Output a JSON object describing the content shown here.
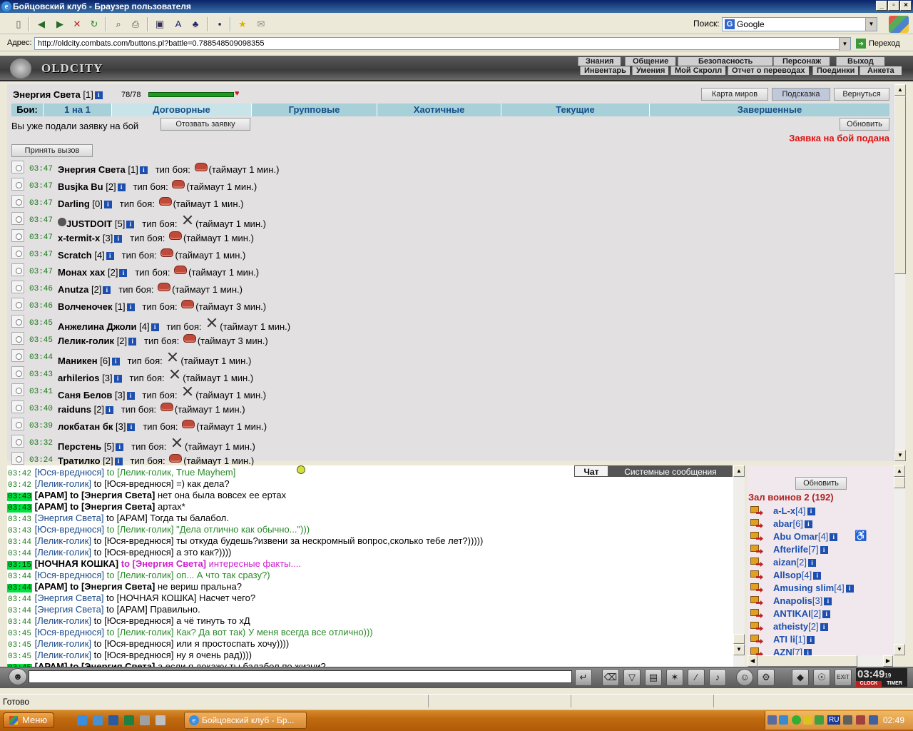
{
  "window": {
    "title": "Бойцовский клуб - Браузер пользователя"
  },
  "toolbar": {
    "search_label": "Поиск:",
    "search_value": "Google"
  },
  "address": {
    "label": "Адрес:",
    "url": "http://oldcity.combats.com/buttons.pl?battle=0.788548509098355",
    "go": "Переход"
  },
  "game": {
    "logo": "OLDCITY",
    "menu_top": [
      "Знания",
      "Общение",
      "Безопасность",
      "Персонаж",
      "Выход"
    ],
    "menu_bottom": [
      "Инвентарь",
      "Умения",
      "Мой Скролл",
      "Отчет о переводах",
      "Поединки",
      "Анкета"
    ]
  },
  "char": {
    "name": "Энергия Света",
    "level": "[1]",
    "hp": "78/78",
    "hp_fraction": 1.0
  },
  "buttons": {
    "map": "Карта миров",
    "hint": "Подсказка",
    "back": "Вернуться",
    "refresh": "Обновить",
    "withdraw": "Отозвать заявку",
    "accept": "Принять вызов"
  },
  "tabs": {
    "label": "Бои:",
    "items": [
      "1 на 1",
      "Договорные",
      "Групповые",
      "Хаотичные",
      "Текущие",
      "Завершенные"
    ]
  },
  "applied_text": "Вы уже подали заявку на бой",
  "status_text": "Заявка на бой подана",
  "fight_type_label": "тип боя:",
  "fights": [
    {
      "time": "03:47",
      "name": "Энергия Света",
      "level": "[1]",
      "type": "fist",
      "timeout": "(таймаут 1 мин.)"
    },
    {
      "time": "03:47",
      "name": "Busjka Bu",
      "level": "[2]",
      "type": "fist",
      "timeout": "(таймаут 1 мин.)"
    },
    {
      "time": "03:47",
      "name": "Darling",
      "level": "[0]",
      "type": "fist",
      "timeout": "(таймаут 1 мин.)"
    },
    {
      "time": "03:47",
      "name": "JUSTDOIT",
      "level": "[5]",
      "type": "swords",
      "timeout": "(таймаут 1 мин.)"
    },
    {
      "time": "03:47",
      "name": "x-termit-x",
      "level": "[3]",
      "type": "fist",
      "timeout": "(таймаут 1 мин.)"
    },
    {
      "time": "03:47",
      "name": "Scratch",
      "level": "[4]",
      "type": "fist",
      "timeout": "(таймаут 1 мин.)"
    },
    {
      "time": "03:47",
      "name": "Монах хах",
      "level": "[2]",
      "type": "fist",
      "timeout": "(таймаут 1 мин.)"
    },
    {
      "time": "03:46",
      "name": "Anutza",
      "level": "[2]",
      "type": "fist",
      "timeout": "(таймаут 1 мин.)"
    },
    {
      "time": "03:46",
      "name": "Волченочек",
      "level": "[1]",
      "type": "fist",
      "timeout": "(таймаут 3 мин.)"
    },
    {
      "time": "03:45",
      "name": "Анжелина Джоли",
      "level": "[4]",
      "type": "swords",
      "timeout": "(таймаут 1 мин.)"
    },
    {
      "time": "03:45",
      "name": "Лелик-голик",
      "level": "[2]",
      "type": "fist",
      "timeout": "(таймаут 3 мин.)"
    },
    {
      "time": "03:44",
      "name": "Маникен",
      "level": "[6]",
      "type": "swords",
      "timeout": "(таймаут 1 мин.)"
    },
    {
      "time": "03:43",
      "name": "arhilerios",
      "level": "[3]",
      "type": "swords",
      "timeout": "(таймаут 1 мин.)"
    },
    {
      "time": "03:41",
      "name": "Саня Белов",
      "level": "[3]",
      "type": "swords",
      "timeout": "(таймаут 1 мин.)"
    },
    {
      "time": "03:40",
      "name": "raiduns",
      "level": "[2]",
      "type": "fist",
      "timeout": "(таймаут 1 мин.)"
    },
    {
      "time": "03:39",
      "name": "локбатан бк",
      "level": "[3]",
      "type": "fist",
      "timeout": "(таймаут 1 мин.)"
    },
    {
      "time": "03:32",
      "name": "Перстень",
      "level": "[5]",
      "type": "swords",
      "timeout": "(таймаут 1 мин.)"
    },
    {
      "time": "03:24",
      "name": "Тратилко",
      "level": "[2]",
      "type": "fist",
      "timeout": "(таймаут 1 мин.)"
    }
  ],
  "chat_tabs": [
    "Чат",
    "Системные сообщения"
  ],
  "chat": [
    {
      "t": "03:42",
      "hl": false,
      "from": "[Юся-вреднюся]",
      "to": "to [Лелик-голик, True Mayhem]",
      "msg": "",
      "color": "#2a8a2a",
      "bold": false
    },
    {
      "t": "03:42",
      "hl": false,
      "from": "[Лелик-голик]",
      "to": "to [Юся-вреднюся]",
      "msg": "=) как дела?",
      "color": "#000000",
      "bold": false
    },
    {
      "t": "03:43",
      "hl": true,
      "from": "[АРАМ]",
      "to": "to [Энергия Света]",
      "msg": "нет она была вовсех ее ертах",
      "color": "#000000",
      "bold": true
    },
    {
      "t": "03:43",
      "hl": true,
      "from": "[АРАМ]",
      "to": "to [Энергия Света]",
      "msg": "артах*",
      "color": "#000000",
      "bold": true
    },
    {
      "t": "03:43",
      "hl": false,
      "from": "[Энергия Света]",
      "to": "to [АРАМ]",
      "msg": "Тогда ты балабол.",
      "color": "#000000",
      "bold": false
    },
    {
      "t": "03:43",
      "hl": false,
      "from": "[Юся-вреднюся]",
      "to": "to [Лелик-голик]",
      "msg": "\"Дела отлично как обычно...\")))",
      "color": "#2a8a2a",
      "bold": false
    },
    {
      "t": "03:44",
      "hl": false,
      "from": "[Лелик-голик]",
      "to": "to [Юся-вреднюся]",
      "msg": "ты откуда будешь?извени за нескромный вопрос,сколько тебе лет?)))))",
      "color": "#000000",
      "bold": false
    },
    {
      "t": "03:44",
      "hl": false,
      "from": "[Лелик-голик]",
      "to": "to [Юся-вреднюся]",
      "msg": "а это как?))))",
      "color": "#000000",
      "bold": false
    },
    {
      "t": "03:15",
      "hl": true,
      "from": "[НОЧНАЯ КОШКА]",
      "to": "to [Энергия Света]",
      "msg": "интересные факты....",
      "color": "#d020d0",
      "bold": true
    },
    {
      "t": "03:44",
      "hl": false,
      "from": "[Юся-вреднюся]",
      "to": "to [Лелик-голик]",
      "msg": "оп... А что так сразу?)",
      "color": "#2a8a2a",
      "bold": false
    },
    {
      "t": "03:44",
      "hl": true,
      "from": "[АРАМ]",
      "to": "to [Энергия Света]",
      "msg": "не вериш пральна?",
      "color": "#000000",
      "bold": true
    },
    {
      "t": "03:44",
      "hl": false,
      "from": "[Энергия Света]",
      "to": "to [НОЧНАЯ КОШКА]",
      "msg": "Насчет чего?",
      "color": "#000000",
      "bold": false
    },
    {
      "t": "03:44",
      "hl": false,
      "from": "[Энергия Света]",
      "to": "to [АРАМ]",
      "msg": "Правильно.",
      "color": "#000000",
      "bold": false
    },
    {
      "t": "03:44",
      "hl": false,
      "from": "[Лелик-голик]",
      "to": "to [Юся-вреднюся]",
      "msg": "а чё тинуть то хД",
      "color": "#000000",
      "bold": false
    },
    {
      "t": "03:45",
      "hl": false,
      "from": "[Юся-вреднюся]",
      "to": "to [Лелик-голик]",
      "msg": "Как? Да вот так) У меня всегда все отлично)))",
      "color": "#2a8a2a",
      "bold": false
    },
    {
      "t": "03:45",
      "hl": false,
      "from": "[Лелик-голик]",
      "to": "to [Юся-вреднюся]",
      "msg": "или я простоспать хочу))))",
      "color": "#000000",
      "bold": false
    },
    {
      "t": "03:45",
      "hl": false,
      "from": "[Лелик-голик]",
      "to": "to [Юся-вреднюся]",
      "msg": "ну я очень рад))))",
      "color": "#000000",
      "bold": false
    },
    {
      "t": "03:45",
      "hl": true,
      "from": "[АРАМ]",
      "to": "to [Энергия Света]",
      "msg": "а если я докажу ты балабол по жизни?",
      "color": "#000000",
      "bold": true
    }
  ],
  "room": {
    "refresh": "Обновить",
    "title": "Зал воинов 2 (192)",
    "users": [
      {
        "name": "a-L-x",
        "level": "[4]"
      },
      {
        "name": "abar",
        "level": "[6]"
      },
      {
        "name": "Abu Omar",
        "level": "[4]"
      },
      {
        "name": "Afterlife",
        "level": "[7]"
      },
      {
        "name": "aizan",
        "level": "[2]"
      },
      {
        "name": "Allsop",
        "level": "[4]"
      },
      {
        "name": "Amusing slim",
        "level": "[4]"
      },
      {
        "name": "Anapolis",
        "level": "[3]"
      },
      {
        "name": "ANTIKAI",
        "level": "[2]"
      },
      {
        "name": "atheisty",
        "level": "[2]"
      },
      {
        "name": "ATI li",
        "level": "[1]"
      },
      {
        "name": "AZN",
        "level": "[7]"
      }
    ]
  },
  "clock": {
    "time": "03:49",
    "sec": "19",
    "clock_label": "CLOCK",
    "timer_label": "TIMER"
  },
  "statusbar": {
    "text": "Готово"
  },
  "taskbar": {
    "start": "Меню",
    "item": "Бойцовский клуб - Бр...",
    "lang": "RU",
    "time": "02:49"
  }
}
